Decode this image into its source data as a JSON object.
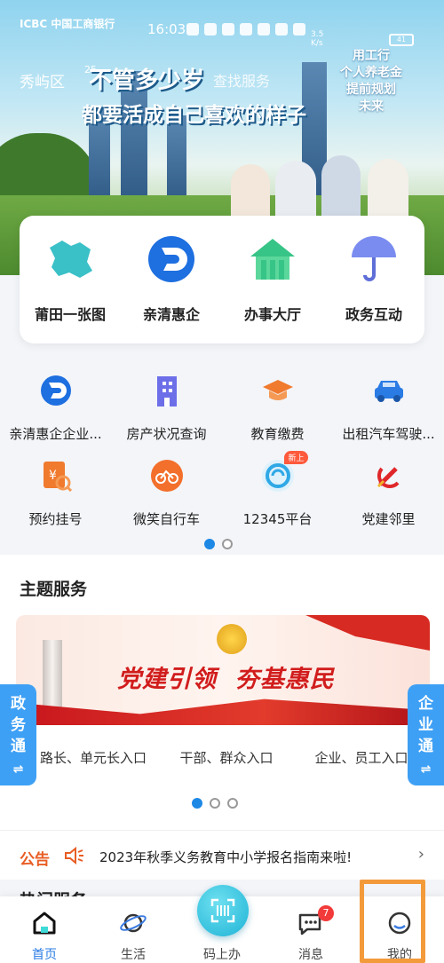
{
  "status_bar": {
    "carrier_logo": "ICBC 中国工商银行",
    "time": "16:03",
    "net_speed": "3.5\nK/s",
    "battery": "41"
  },
  "banner": {
    "location": "秀屿区",
    "weather": "25 ...",
    "search_placeholder": "查找服务",
    "slogan_line1": "不管多少岁",
    "slogan_line2": "都要活成自己喜欢的样子",
    "ad_text": [
      "用工行",
      "个人养老金",
      "提前规划",
      "未来"
    ]
  },
  "main_services": [
    {
      "label": "莆田一张图",
      "icon": "map-icon",
      "color": "#3ac0c7"
    },
    {
      "label": "亲清惠企",
      "icon": "qinqing-logo-icon",
      "color": "#1e6fe0"
    },
    {
      "label": "办事大厅",
      "icon": "hall-building-icon",
      "color": "#37c487"
    },
    {
      "label": "政务互动",
      "icon": "umbrella-icon",
      "color": "#7a8cf0"
    }
  ],
  "service_grid": [
    [
      {
        "label": "亲清惠企企业...",
        "icon": "qinqing-logo-icon"
      },
      {
        "label": "房产状况查询",
        "icon": "building-icon"
      },
      {
        "label": "教育缴费",
        "icon": "graduation-cap-icon"
      },
      {
        "label": "出租汽车驾驶...",
        "icon": "car-icon"
      }
    ],
    [
      {
        "label": "预约挂号",
        "icon": "registration-icon"
      },
      {
        "label": "微笑自行车",
        "icon": "bicycle-logo-icon"
      },
      {
        "label": "12345平台",
        "icon": "hotline-12345-icon",
        "badge": "新上"
      },
      {
        "label": "党建邻里",
        "icon": "party-emblem-icon"
      }
    ]
  ],
  "theme_services": {
    "title": "主题服务",
    "banner_slogan": "党建引领  夯基惠民",
    "entries": [
      "路长、单元长入口",
      "干部、群众入口",
      "企业、员工入口"
    ]
  },
  "side_tabs": {
    "left": [
      "政",
      "务",
      "通"
    ],
    "right": [
      "企",
      "业",
      "通"
    ]
  },
  "notice": {
    "tag": "公告",
    "text": "2023年秋季义务教育中小学报名指南来啦!"
  },
  "hot_services_title": "热门服务",
  "bottom_nav": {
    "home": "首页",
    "life": "生活",
    "scan": "码上办",
    "messages": "消息",
    "messages_badge": "7",
    "mine": "我的"
  },
  "colors": {
    "accent_blue": "#2a7be4",
    "side_tab_blue": "#3ea0f5",
    "notice_orange": "#e85d24",
    "highlight_orange": "#f39a3a"
  }
}
